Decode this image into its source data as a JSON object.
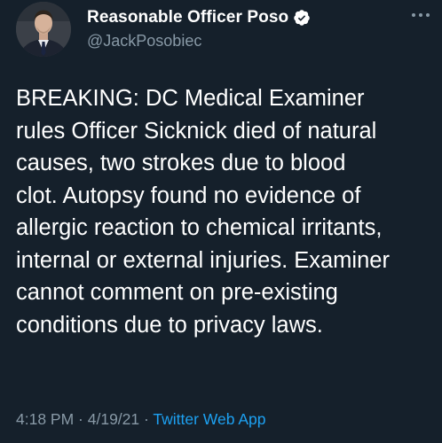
{
  "tweet": {
    "display_name": "Reasonable Officer Poso",
    "handle": "@JackPosobiec",
    "verified": true,
    "text": "BREAKING: DC Medical Examiner\nrules Officer Sicknick died of natural\ncauses, two strokes due to blood\nclot. Autopsy found no evidence of\nallergic reaction to chemical irritants,\ninternal or external injuries. Examiner\ncannot comment on pre-existing\nconditions due to privacy laws.",
    "time": "4:18 PM",
    "separator1": " · ",
    "date": "4/19/21",
    "separator2": " · ",
    "source": "Twitter Web App"
  },
  "icons": {
    "verified": "verified-badge-icon",
    "more": "more-options-icon"
  },
  "colors": {
    "background": "#15202b",
    "text": "#ffffff",
    "secondary": "#8899a6",
    "accent": "#1da1f2"
  }
}
